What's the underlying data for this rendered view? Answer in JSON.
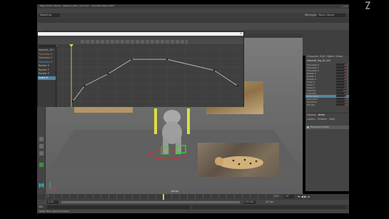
{
  "app": {
    "title": "Maya 2018: /Users/.../leopard_walk_cycle.mb* - Autodesk Maya 2018",
    "logo_letter": "M"
  },
  "menubar": [
    "File",
    "Edit",
    "Create",
    "Select",
    "Modify",
    "Display",
    "Windows",
    "Mesh",
    "Edit Mesh",
    "Mesh Tools",
    "Mesh Display",
    "Curves",
    "Surfaces",
    "Deform",
    "UV",
    "Generate",
    "Cache",
    "Arnold",
    "Help"
  ],
  "status_line": {
    "mode": "Modeling",
    "workspace_label": "Workspace:",
    "workspace_value": "Maya Classic"
  },
  "shelf_tabs": [
    "Curves / Surfaces",
    "Poly Modeling",
    "Sculpting",
    "Rigging",
    "Animation",
    "Rendering",
    "FX",
    "FX Caching",
    "Custom",
    "Arnold",
    "Bifrost",
    "MASH",
    "Motion Graphics",
    "XGen"
  ],
  "graph_editor": {
    "menu": [
      "Edit",
      "View",
      "Select",
      "Curves",
      "Keys",
      "Tangents",
      "List",
      "Show",
      "Help"
    ],
    "search_placeholder": "Search...",
    "outliner_items": [
      "leopard_ctrl",
      "Translate X",
      "Translate Y",
      "Translate Z",
      "Rotate X",
      "Rotate Y",
      "Rotate Z",
      "Scale X"
    ],
    "curve_keys": [
      0,
      2,
      6,
      10,
      16,
      24,
      28
    ],
    "curve_values": [
      0.0,
      0.35,
      0.62,
      0.95,
      0.95,
      0.7,
      0.35
    ]
  },
  "channel_box": {
    "tabs": [
      "Channels",
      "Edit",
      "Object",
      "Show"
    ],
    "object": "leopard_leg_IK_ctrl",
    "attributes": [
      {
        "name": "Translate X",
        "value": "0"
      },
      {
        "name": "Translate Y",
        "value": "0"
      },
      {
        "name": "Translate Z",
        "value": "0"
      },
      {
        "name": "Rotate X",
        "value": "0"
      },
      {
        "name": "Rotate Y",
        "value": "0"
      },
      {
        "name": "Rotate Z",
        "value": "0"
      },
      {
        "name": "Scale X",
        "value": "1"
      },
      {
        "name": "Scale Y",
        "value": "1"
      },
      {
        "name": "Scale Z",
        "value": "1"
      },
      {
        "name": "Visibility",
        "value": "on"
      },
      {
        "name": "Foot Roll",
        "value": "0"
      },
      {
        "name": "Knee Twist",
        "value": "0"
      },
      {
        "name": "Heel Pivot",
        "value": "0"
      },
      {
        "name": "Toe Pivot",
        "value": "0"
      },
      {
        "name": "Toe Tap",
        "value": "0"
      }
    ],
    "highlight_index": 11,
    "layer_tabs": [
      "Display",
      "Anim"
    ],
    "layer_menu": [
      "Layers",
      "Options",
      "Help"
    ],
    "layer_name": "BaseAnimation"
  },
  "viewport": {
    "panel_menu": [
      "View",
      "Shading",
      "Lighting",
      "Show",
      "Renderer",
      "Panels"
    ],
    "camera_label": "persp"
  },
  "timeline": {
    "start": "1",
    "end": "120",
    "current": "24",
    "range_start": "1.00",
    "range_end": "120.00",
    "fps": "24 fps"
  },
  "command_line": {
    "lang": "MEL",
    "help_text": "Select Tool: select an object"
  },
  "colors": {
    "bg": "#444444",
    "accent": "#5285a6",
    "selected": "#70e070",
    "key_red": "#cc3333"
  }
}
